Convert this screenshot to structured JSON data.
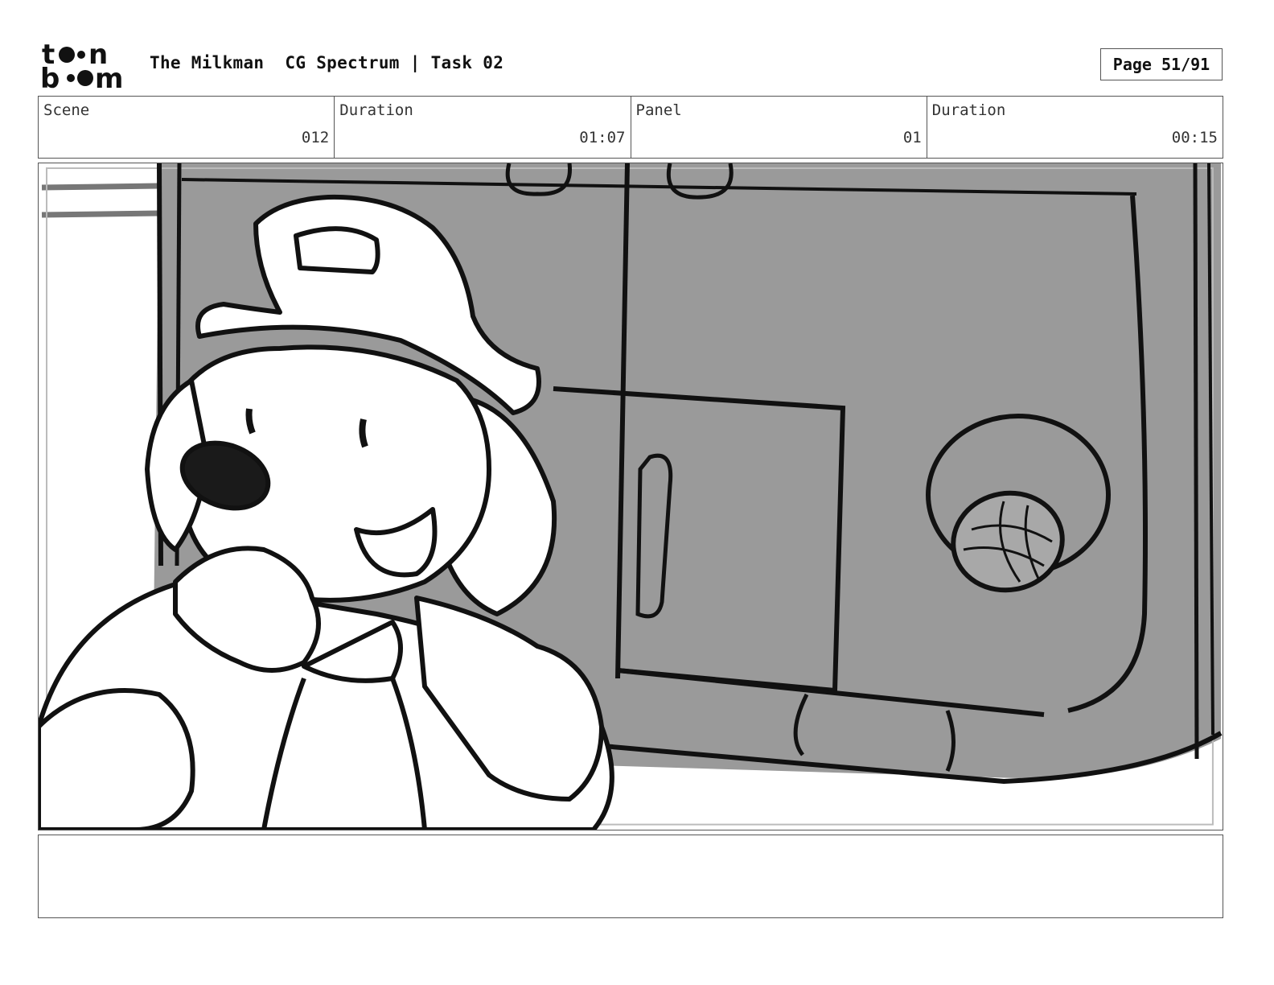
{
  "header": {
    "logo": {
      "text": "toon boom",
      "icon": "toon-boom-logo"
    },
    "project_title": "The Milkman",
    "subtitle": "CG Spectrum | Task 02",
    "page_label": "Page 51/91"
  },
  "info": {
    "scene_label": "Scene",
    "scene_value": "012",
    "scene_duration_label": "Duration",
    "scene_duration_value": "01:07",
    "panel_label": "Panel",
    "panel_value": "01",
    "panel_duration_label": "Duration",
    "panel_duration_value": "00:15"
  },
  "panel_image": {
    "description_icon": "storyboard-sketch",
    "background_color": "#9a9a9a",
    "line_color": "#111111"
  },
  "notes": {
    "text": ""
  }
}
